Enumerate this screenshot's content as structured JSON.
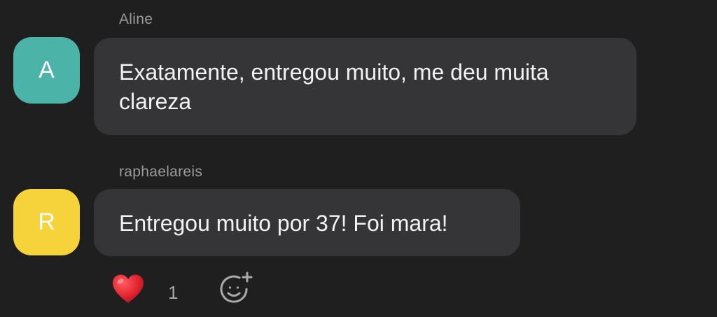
{
  "messages": [
    {
      "author": "Aline",
      "avatar_letter": "A",
      "avatar_color": "#4bb3a8",
      "text_lines": [
        "Exatamente, entregou muito, me deu muita",
        "clareza"
      ]
    },
    {
      "author": "raphaelareis",
      "avatar_letter": "R",
      "avatar_color": "#f6d33a",
      "text": "Entregou muito por 37! Foi mara!"
    }
  ],
  "reactions": {
    "heart_icon": "heart-icon",
    "heart_count": "1",
    "add_reaction_icon": "add-reaction-icon"
  },
  "colors": {
    "background": "#1f1f20",
    "bubble": "#353537",
    "author_text": "#9a9a9c",
    "heart": "#e52632"
  }
}
